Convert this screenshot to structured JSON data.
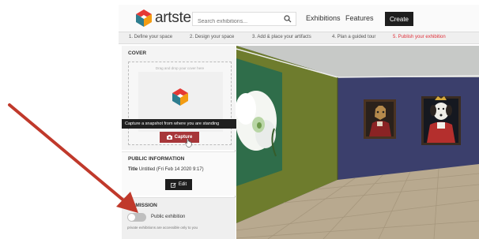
{
  "header": {
    "brand": "artsteps",
    "search_placeholder": "Search exhibitions...",
    "nav": [
      "Exhibitions",
      "Features"
    ],
    "create_label": "Create"
  },
  "steps": [
    {
      "label": "1. Define your space",
      "active": false
    },
    {
      "label": "2. Design your space",
      "active": false
    },
    {
      "label": "3. Add & place your artifacts",
      "active": false
    },
    {
      "label": "4. Plan a guided tour",
      "active": false
    },
    {
      "label": "5. Publish your exhibition",
      "active": true
    }
  ],
  "cover": {
    "title": "COVER",
    "drop_text": "Drag and drop your cover here",
    "tooltip": "Capture a snapshot from where you are standing",
    "capture_label": "Capture"
  },
  "public_info": {
    "title": "PUBLIC INFORMATION",
    "title_label": "Title",
    "title_value": "Untitled (Fri Feb 14 2020 9:17)",
    "edit_label": "Edit"
  },
  "admission": {
    "title": "ADMISSION",
    "toggle_label": "Public exhibition",
    "toggle_on": false,
    "note": "private exhibitions are accessible only to you"
  },
  "colors": {
    "accent": "#e0303a",
    "capture_button": "#a73639",
    "dark_button": "#1e1e1e",
    "arrow": "#c0392b",
    "wall_green": "#6b7a2c",
    "wall_navy": "#3a3f6a"
  },
  "icons": [
    "logo-icon",
    "search-icon",
    "camera-icon",
    "edit-icon",
    "cursor-icon",
    "annotation-arrow"
  ]
}
